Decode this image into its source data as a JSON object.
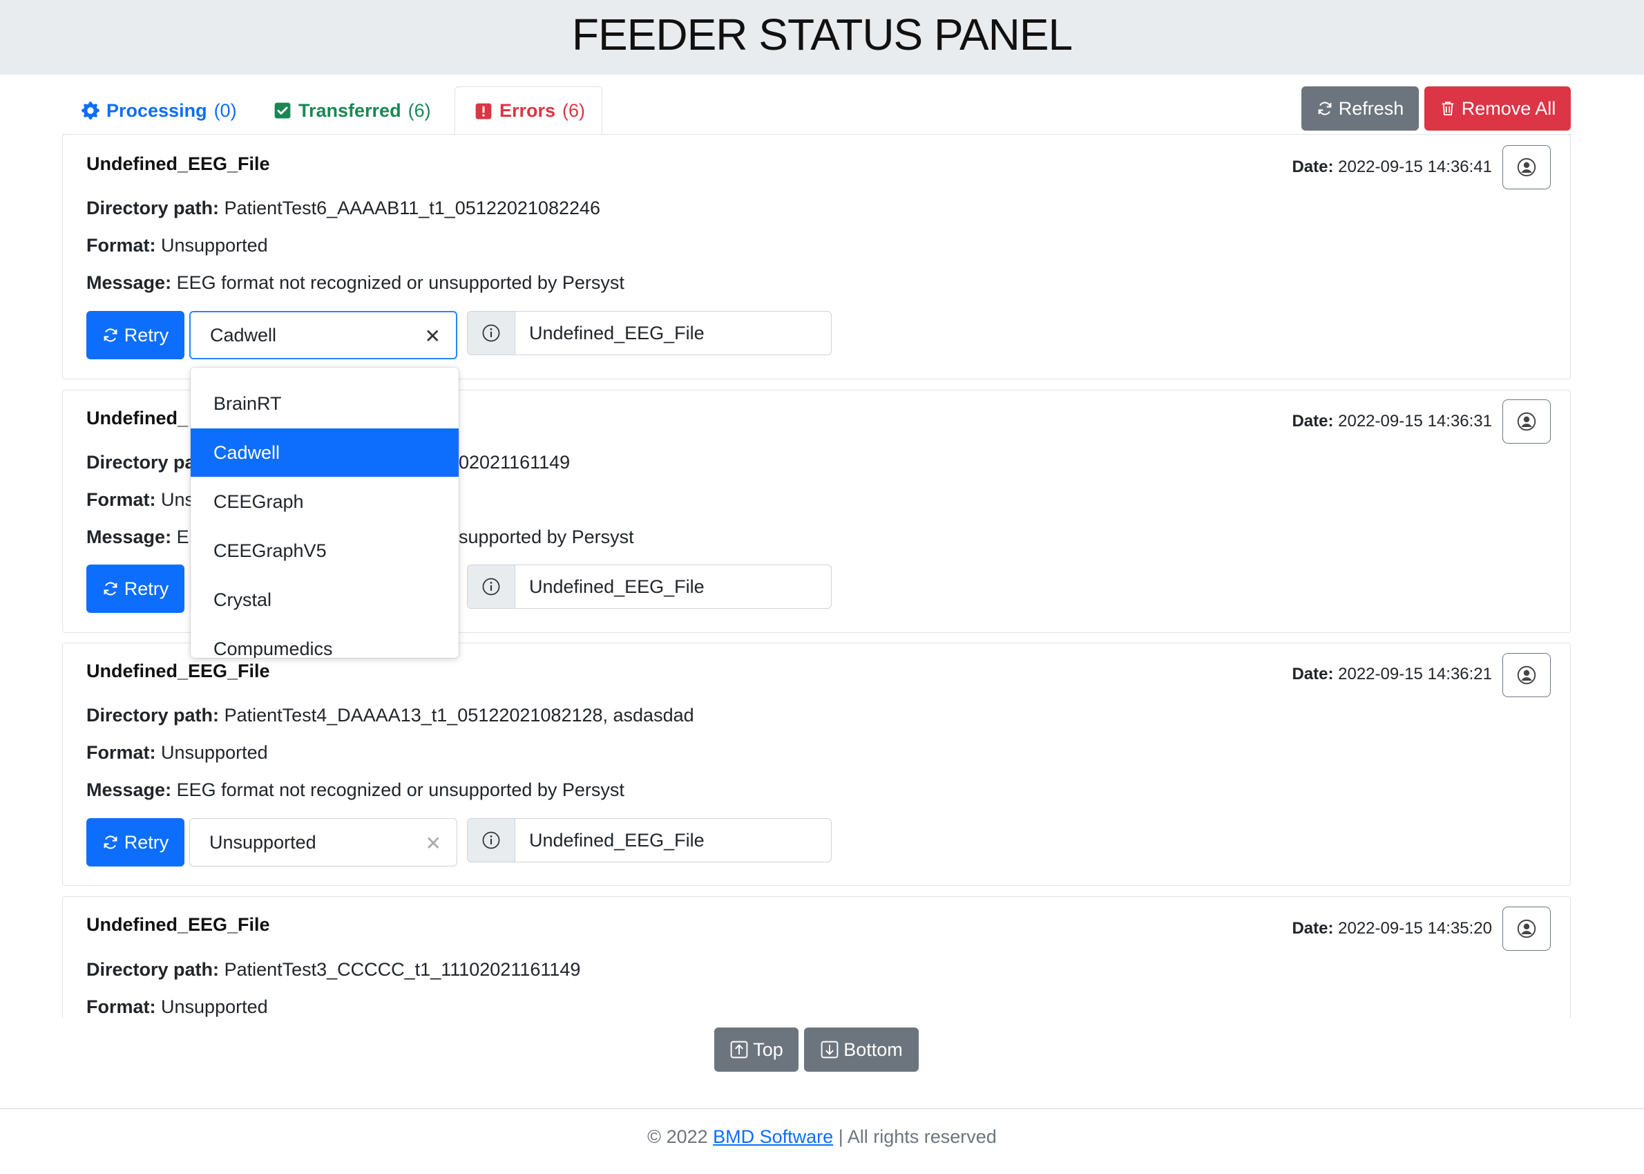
{
  "header": {
    "title": "FEEDER STATUS PANEL"
  },
  "tabs": [
    {
      "label": "Processing",
      "count": "(0)",
      "icon": "gear-icon",
      "color": "#0d6efd"
    },
    {
      "label": "Transferred",
      "count": "(6)",
      "icon": "check-square-icon",
      "color": "#198754"
    },
    {
      "label": "Errors",
      "count": "(6)",
      "icon": "exclamation-square-icon",
      "color": "#dc3545"
    }
  ],
  "toolbar": {
    "refresh_label": "Refresh",
    "remove_all_label": "Remove All"
  },
  "labels": {
    "date": "Date:",
    "directory_path": "Directory path:",
    "format": "Format:",
    "message": "Message:",
    "retry": "Retry"
  },
  "entries": [
    {
      "title": "Undefined_EEG_File",
      "date": "2022-09-15 14:36:41",
      "directory_path": "PatientTest6_AAAAB11_t1_05122021082246",
      "format": "Unsupported",
      "message": "EEG format not recognized or unsupported by Persyst",
      "selected_format": "Cadwell",
      "file_name": "Undefined_EEG_File"
    },
    {
      "title": "Undefined_",
      "date": "2022-09-15 14:36:31",
      "directory_path_visible_prefix": "Directory pa",
      "directory_path_visible_suffix": "02021161149",
      "format_visible": "Uns",
      "message_visible_prefix": "E",
      "message_visible_suffix": "supported by Persyst",
      "file_name": "Undefined_EEG_File"
    },
    {
      "title": "Undefined_EEG_File",
      "date": "2022-09-15 14:36:21",
      "directory_path": "PatientTest4_DAAAA13_t1_05122021082128, asdasdad",
      "format": "Unsupported",
      "message": "EEG format not recognized or unsupported by Persyst",
      "selected_format": "Unsupported",
      "file_name": "Undefined_EEG_File"
    },
    {
      "title": "Undefined_EEG_File",
      "date": "2022-09-15 14:35:20",
      "directory_path": "PatientTest3_CCCCC_t1_11102021161149",
      "format": "Unsupported"
    }
  ],
  "format_dropdown": {
    "options": [
      "BrainRT",
      "Cadwell",
      "CEEGraph",
      "CEEGraphV5",
      "Crystal",
      "Compumedics"
    ],
    "selected": "Cadwell"
  },
  "scroll_controls": {
    "top_label": "Top",
    "bottom_label": "Bottom"
  },
  "footer": {
    "prefix": "© 2022 ",
    "link_text": "BMD Software",
    "suffix": " | All rights reserved"
  },
  "colors": {
    "primary": "#0d6efd",
    "danger": "#dc3545",
    "success": "#198754",
    "secondary": "#6c757d"
  }
}
